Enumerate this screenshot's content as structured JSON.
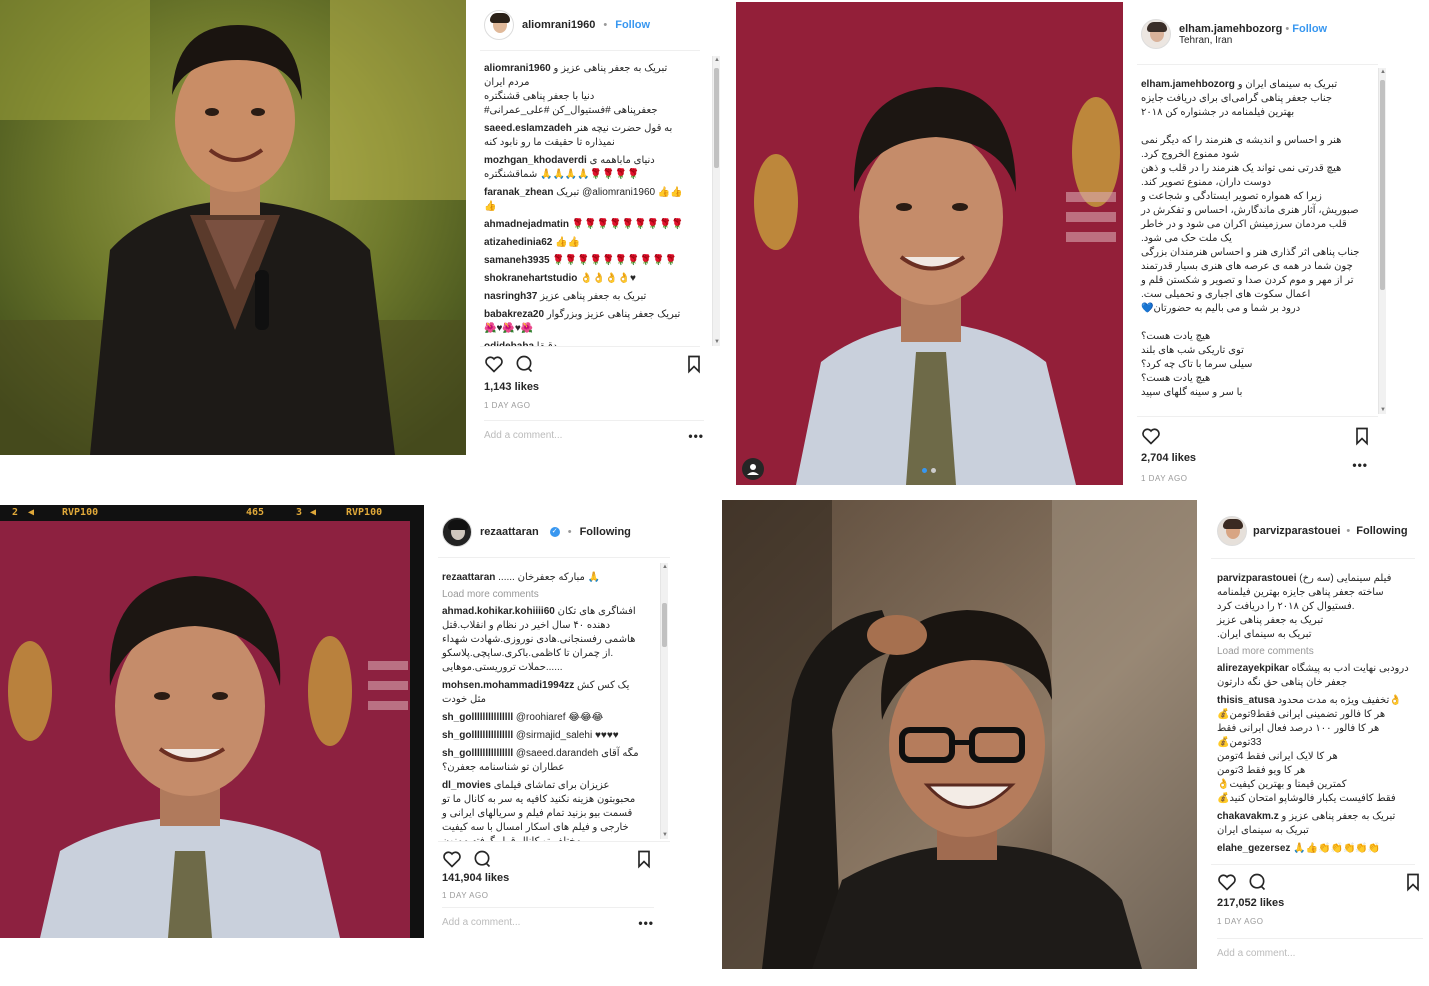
{
  "posts": [
    {
      "username": "aliomrani1960",
      "follow_label": "Follow",
      "likes": "1,143 likes",
      "ago": "1 DAY AGO",
      "add_comment": "Add a comment...",
      "comments": [
        {
          "user": "aliomrani1960",
          "text": "تبریک به جعفر پناهی عزیز و مردم ایران\nدنیا با جعفر پناهی قشنگتره\nجعفرپناهی #فستیوال_کن #علی_عمرانی#"
        },
        {
          "user": "saeed.eslamzadeh",
          "text": "به قول حضرت نیچه هنر نمیذاره تا حقیقت ما رو نابود کنه"
        },
        {
          "user": "mozhgan_khodaverdi",
          "text": "دنیای ماباهمه ی شماقشنگتره 🙏🙏🙏🙏🌹🌹🌹🌹"
        },
        {
          "user": "faranak_zhean",
          "text": "تبریک @aliomrani1960 👍👍👍"
        },
        {
          "user": "ahmadnejadmatin",
          "text": "🌹🌹🌹🌹🌹🌹🌹🌹🌹"
        },
        {
          "user": "atizahedinia62",
          "text": "👍👍"
        },
        {
          "user": "samaneh3935",
          "text": "🌹🌹🌹🌹🌹🌹🌹🌹🌹🌹"
        },
        {
          "user": "shokranehartstudio",
          "text": "👌👌👌👌♥"
        },
        {
          "user": "nasringh37",
          "text": "تبریک به جعفر پناهی عزیز"
        },
        {
          "user": "babakreza20",
          "text": "تبریک جعفر پناهی عزیز وبزرگوار🌺♥🌺♥🌺"
        },
        {
          "user": "odidebaba",
          "text": "دقیقا"
        }
      ]
    },
    {
      "username": "elham.jamehbozorg",
      "follow_label": "Follow",
      "location": "Tehran, Iran",
      "likes": "2,704 likes",
      "ago": "1 DAY AGO",
      "comments": [
        {
          "user": "elham.jamehbozorg",
          "text": "تبریک به سینمای ایران و جناب جعفر پناهی گرامی‌ای برای دریافت جایزه بهترین فیلمنامه در جشنواره کن ۲۰۱۸\n\nهنر و احساس و اندیشه ی هنرمند را که دیگر نمی شود ممنوع الخروج کرد.\nهیچ قدرتی نمی تواند یک هنرمند را در قلب و ذهن دوست داران، ممنوع تصویر کند.\nزیرا که همواره تصویر ایستادگی و شجاعت و صبوریش، آثار هنری ماندگارش، احساس و تفکرش در قلب مردمان سرزمینش اکران می شود و در خاطر یک ملت حک می شود.\nجناب پناهی اثر گذاری هنر و احساس هنرمندان بزرگی چون شما در همه ی عرصه های هنری بسیار قدرتمند تر از مهر و موم کردن صدا و تصویر و شکستن قلم و اعمال سکوت های اجباری و تحمیلی ست.\nدرود بر شما و می بالیم به حضورتان💙\n\nهیچ یادت هست؟\nتوی تاریکی شب های بلند\nسیلی سرما با تاک چه کرد؟\nهیچ یادت هست؟\nبا سر و سینه گلهای سپید"
        }
      ]
    },
    {
      "username": "rezaattaran",
      "follow_label": "Following",
      "likes": "141,904 likes",
      "ago": "1 DAY AGO",
      "add_comment": "Add a comment...",
      "load_more": "Load more comments",
      "comments": [
        {
          "user": "rezaattaran",
          "text": "...... مبارکه جعفرخان 🙏"
        },
        {
          "user": "ahmad.kohikar.kohiiii60",
          "text": "افشاگری های تکان دهنده ۴۰ سال اخیر در نظام و انقلاب.قتل هاشمی رفسنجانی.هادی نوروزی.شهادت شهداء از چمران تا کاظمی.باکری.ساپچی.پلاسکو.\n......حملات تروریستی.موهایی"
        },
        {
          "user": "mohsen.mohammadi1994zz",
          "text": "یک کس کش مثل خودت"
        },
        {
          "user": "sh_golllllllllllllll",
          "text": "@roohiaref 😂😂😂"
        },
        {
          "user": "sh_golllllllllllllll",
          "text": "@sirmajid_salehi ♥♥♥♥"
        },
        {
          "user": "sh_golllllllllllllll",
          "text": "@saeed.darandeh مگه آقای عطاران تو شناسنامه جعفرن؟"
        },
        {
          "user": "dl_movies",
          "text": "عزیزان برای تماشای فیلمای محبوبتون هزینه نکنید کافیه یه سر به کانال ما تو قسمت بیو بزنید تمام فیلم و سریالهای ایرانی و خارجی و فیلم های اسکار امسال با سه کیفیت مختلف تو کانال قرار گرفته ممنون"
        }
      ]
    },
    {
      "username": "parvizparastouei",
      "follow_label": "Following",
      "likes": "217,052 likes",
      "ago": "1 DAY AGO",
      "add_comment": "Add a comment...",
      "load_more": "Load more comments",
      "comments": [
        {
          "user": "parvizparastouei",
          "text": "فیلم سینمایی (سه رخ) ساخته جعفر پناهی جایزه بهترین فیلمنامه فستیوال کن ۲۰۱۸ را دریافت کرد.\nتبریک به جعفر پناهی عزیز\nتبریک به سینمای ایران."
        },
        {
          "user": "alirezayekpikar",
          "text": "درودبی نهایت ادب به پیشگاه جعفر خان پناهی حق نگه دارتون"
        },
        {
          "user": "thisis_atusa",
          "text": "تخفیف ویژه به مدت محدود👌\nهر کا فالور تضمینی ایرانی فقط9تومن💰\nهر کا فالور ۱۰۰ درصد فعال ایرانی فقط 33تومن💰\nهر کا لایک ایرانی فقط 4تومن\nهر کا ویو فقط 3تومن\nکمترین قیمتا و بهترین کیفیت👌\nفقط کافیست یکبار فالوشاپو امتحان کنید💰"
        },
        {
          "user": "chakavakm.z",
          "text": "تبریک به جعفر پناهی عزیز و تبریک به سینمای ایران"
        },
        {
          "user": "elahe_gezersez",
          "text": "🙏👍👏👏👏👏👏"
        }
      ]
    }
  ],
  "film_strip": {
    "left_num": "2",
    "left_brand": "RVP100",
    "mid_num": "465",
    "right_num": "3",
    "right_brand": "RVP100"
  },
  "colors": {
    "follow": "#3897f0",
    "backdrop_red": "#8e1f3a",
    "muted": "#999999"
  }
}
